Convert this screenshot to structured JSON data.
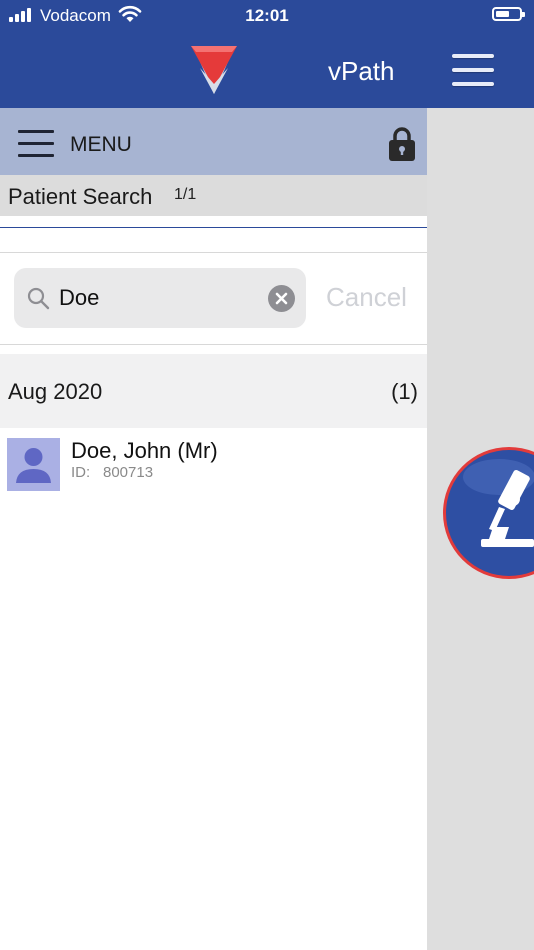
{
  "status_bar": {
    "carrier": "Vodacom",
    "time": "12:01"
  },
  "app_bar": {
    "title": "vPath",
    "brand_color": "#2b4a9a"
  },
  "menu": {
    "label": "MENU"
  },
  "page": {
    "title": "Patient Search",
    "count": "1/1"
  },
  "search": {
    "value": "Doe",
    "placeholder": "Search",
    "cancel_label": "Cancel"
  },
  "results": {
    "sections": [
      {
        "header": "Aug 2020",
        "count": "(1)",
        "patients": [
          {
            "name": "Doe, John (Mr)",
            "id_label": "ID:",
            "id_value": "800713"
          }
        ]
      }
    ]
  },
  "icons": {
    "logo": "red-triangle-logo-icon",
    "nav_menu": "hamburger-icon",
    "lock": "lock-icon",
    "search": "search-icon",
    "clear": "clear-icon",
    "avatar": "person-avatar-icon",
    "side": "microscope-icon"
  }
}
